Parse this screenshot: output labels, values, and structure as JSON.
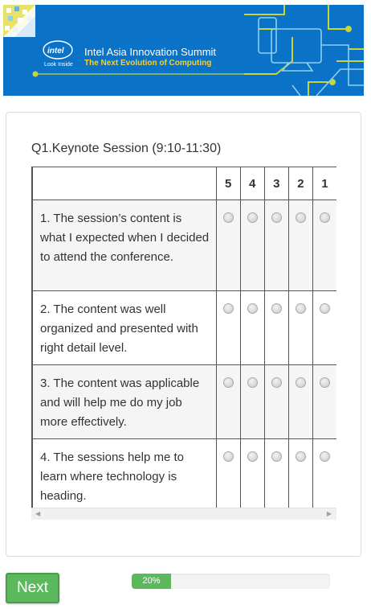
{
  "banner": {
    "logo_word": "intel",
    "logo_tagline": "Look Inside",
    "title": "Intel Asia Innovation Summit",
    "subtitle": "The Next Evolution of Computing",
    "colors": {
      "background": "#0a72c7",
      "subtitle": "#f3d23c",
      "accent": "#c7d53a"
    }
  },
  "question": {
    "title": "Q1.Keynote Session (9:10-11:30)",
    "columns": [
      "5",
      "4",
      "3",
      "2",
      "1"
    ],
    "rows": [
      {
        "label": "1. The session’s content is what I expected when I decided to attend the conference."
      },
      {
        "label": "2. The content was well organized and presented with right detail level."
      },
      {
        "label": "3. The content was applicable and will help me do my job more effectively."
      },
      {
        "label": "4. The sessions help me to learn where technology is heading."
      }
    ],
    "scroll_left_icon": "chevron-left-icon",
    "scroll_right_icon": "chevron-right-icon"
  },
  "footer": {
    "next_label": "Next",
    "progress_text": "20%",
    "progress_value": 0.2,
    "colors": {
      "button": "#5cb85c"
    }
  }
}
